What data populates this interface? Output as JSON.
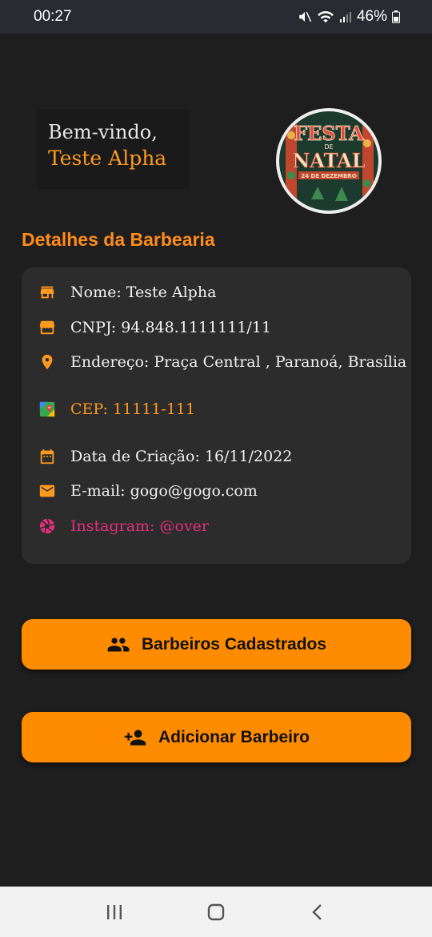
{
  "status_bar": {
    "time": "00:27",
    "battery": "46%"
  },
  "welcome": {
    "greeting": "Bem-vindo,",
    "name": "Teste Alpha"
  },
  "avatar": {
    "poster_title_1": "FESTA",
    "poster_de": "DE",
    "poster_title_2": "NATAL",
    "poster_date": "24 DE DEZEMBRO"
  },
  "section": {
    "title": "Detalhes da Barbearia"
  },
  "details": {
    "nome": "Nome: Teste Alpha",
    "cnpj": "CNPJ: 94.848.1111111/11",
    "endereco": "Endereço: Praça Central , Paranoá, Brasília",
    "cep": "CEP: 11111-111",
    "data_criacao": "Data de Criação: 16/11/2022",
    "email": "E-mail: gogo@gogo.com",
    "instagram": "Instagram: @over"
  },
  "buttons": {
    "barbeiros": "Barbeiros Cadastrados",
    "adicionar": "Adicionar Barbeiro"
  },
  "icons": {
    "store": "store-icon",
    "storefront": "storefront-icon",
    "location": "location-pin-icon",
    "maps": "google-maps-icon",
    "calendar": "calendar-icon",
    "email": "mail-icon",
    "instagram": "instagram-icon",
    "group": "group-icon",
    "add_person": "person-add-icon"
  },
  "colors": {
    "accent": "#ff8c00",
    "background": "#1e1e1e",
    "card": "#2c2c2c",
    "instagram": "#e0307a"
  }
}
